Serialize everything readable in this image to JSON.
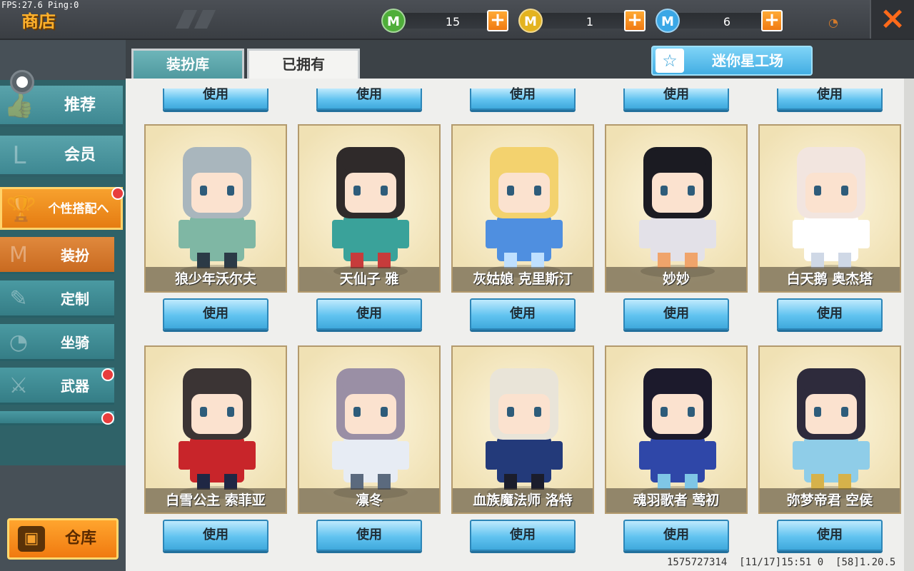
{
  "debug": {
    "fps_text": "FPS:27.6  Ping:0"
  },
  "header": {
    "title": "商店",
    "currencies": [
      {
        "name": "green-gem",
        "color": "#4fae3a",
        "amount": "15"
      },
      {
        "name": "gold-coin",
        "color": "#e3b320",
        "amount": "1"
      },
      {
        "name": "mini-coin",
        "color": "#3aa7e6",
        "amount": "6"
      }
    ],
    "close_icon": "×"
  },
  "sidebar": {
    "items": [
      {
        "key": "recommend",
        "label": "推荐",
        "icon": "👍"
      },
      {
        "key": "member",
        "label": "会员",
        "icon": "L"
      },
      {
        "key": "style",
        "label": "个性搭配へ",
        "icon": "🏆"
      }
    ],
    "sub_items": [
      {
        "key": "dressup",
        "label": "装扮",
        "icon": "M"
      },
      {
        "key": "custom",
        "label": "定制",
        "icon": "✎"
      },
      {
        "key": "mount",
        "label": "坐骑",
        "icon": "◔"
      },
      {
        "key": "weapon",
        "label": "武器",
        "icon": "⚔"
      }
    ],
    "warehouse_label": "仓库",
    "warehouse_icon": "▣"
  },
  "tabs": [
    {
      "label": "装扮库",
      "active": false
    },
    {
      "label": "已拥有",
      "active": true
    }
  ],
  "workshop": {
    "label": "迷你星工场",
    "icon": "☆"
  },
  "use_label": "使用",
  "cards": [
    {
      "name": "狼少年沃尔夫",
      "palette": [
        "#a9b6bd",
        "#7fb7a4",
        "#2b3a46"
      ]
    },
    {
      "name": "天仙子 雅",
      "palette": [
        "#2f2a2a",
        "#3aa29a",
        "#c73b3b"
      ]
    },
    {
      "name": "灰姑娘 克里斯汀",
      "palette": [
        "#f3d26e",
        "#4f8fe0",
        "#bfe0ff"
      ]
    },
    {
      "name": "妙妙",
      "palette": [
        "#1b1b22",
        "#e3e1e8",
        "#f0a46b"
      ]
    },
    {
      "name": "白天鹅 奥杰塔",
      "palette": [
        "#f2e5df",
        "#ffffff",
        "#cfd8e6"
      ]
    },
    {
      "name": "白雪公主 索菲亚",
      "palette": [
        "#3b3434",
        "#c8252a",
        "#1f2744"
      ]
    },
    {
      "name": "凛冬",
      "palette": [
        "#9a8fa5",
        "#e7ecf4",
        "#5b6a7e"
      ]
    },
    {
      "name": "血族魔法师 洛特",
      "palette": [
        "#e9e4d8",
        "#233a7a",
        "#1b1d2c"
      ]
    },
    {
      "name": "魂羽歌者 莺初",
      "palette": [
        "#1c1a2c",
        "#2f47a8",
        "#7fc6e6"
      ]
    },
    {
      "name": "弥梦帝君 空侯",
      "palette": [
        "#2e2b3c",
        "#8fcde8",
        "#d6b24a"
      ]
    }
  ],
  "footer": {
    "id": "1575727314",
    "time": "[11/17]15:51 0",
    "version": "[58]1.20.5"
  }
}
